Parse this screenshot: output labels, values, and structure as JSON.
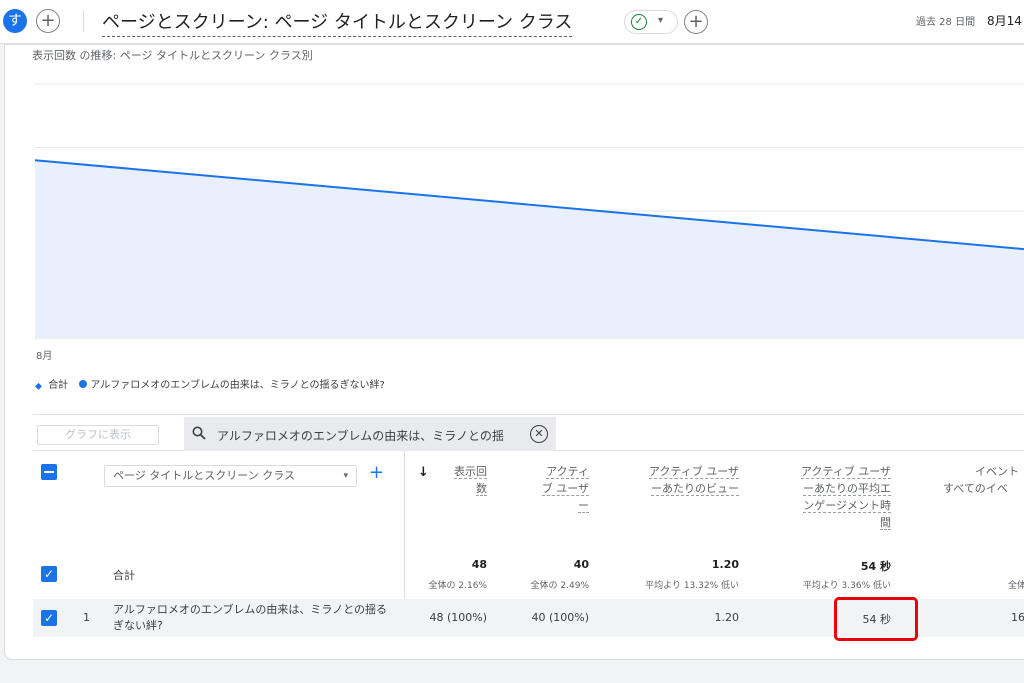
{
  "header": {
    "avatar_letter": "す",
    "add_icon": "plus-icon",
    "title": "ページとスクリーン: ページ タイトルとスクリーン クラス",
    "status_icon": "check-circle-icon",
    "date_range_label": "過去 28 日間",
    "date_range_value": "8月14"
  },
  "chart": {
    "title": "表示回数 の推移: ページ タイトルとスクリーン クラス別",
    "x_tick": "8月",
    "legend": [
      {
        "label": "合計",
        "icon": "water-drop-icon"
      },
      {
        "label": "アルファロメオのエンブレムの由来は、ミラノとの揺るぎない絆?",
        "icon": "dot-icon"
      }
    ],
    "colors": {
      "line": "#1a73e8",
      "area": "#e8f0fe"
    }
  },
  "chart_data": {
    "type": "area",
    "x": [
      "8月"
    ],
    "series": [
      {
        "name": "アルファロメオのエンブレムの由来は、ミラノとの揺るぎない絆?",
        "values": [
          2.8,
          1.4
        ]
      }
    ],
    "xlabel": "",
    "ylabel": "",
    "ylim": [
      0,
      4
    ],
    "grid": true,
    "legend": "bottom-left"
  },
  "toolbar": {
    "graph_button": "グラフに表示",
    "search_icon": "search-icon",
    "search_value": "アルファロメオのエンブレムの由来は、ミラノとの揺",
    "clear_icon": "clear-circle-icon"
  },
  "table": {
    "dimension": "ページ タイトルとスクリーン クラス",
    "add_dimension": "+",
    "sort_icon": "arrow-down-icon",
    "columns": [
      {
        "lines": [
          "表示回",
          "数"
        ]
      },
      {
        "lines": [
          "アクティ",
          "ブ ユーザ",
          "ー"
        ]
      },
      {
        "lines": [
          "アクティブ ユーザ",
          "ーあたりのビュー"
        ]
      },
      {
        "lines": [
          "アクティブ ユーザ",
          "ーあたりの平均エ",
          "ンゲージメント時",
          "間"
        ]
      },
      {
        "lines": [
          "イベント",
          "すべてのイベ"
        ]
      }
    ],
    "total": {
      "label": "合計",
      "values": [
        "48",
        "40",
        "1.20",
        "54 秒"
      ],
      "subs": [
        "全体の 2.16%",
        "全体の 2.49%",
        "平均より 13.32% 低い",
        "平均より 3.36% 低い",
        "全体"
      ]
    },
    "rows": [
      {
        "index": "1",
        "title": "アルファロメオのエンブレムの由来は、ミラノとの揺るぎない絆?",
        "values": [
          "48 (100%)",
          "40 (100%)",
          "1.20",
          "54 秒",
          "16"
        ]
      }
    ]
  }
}
